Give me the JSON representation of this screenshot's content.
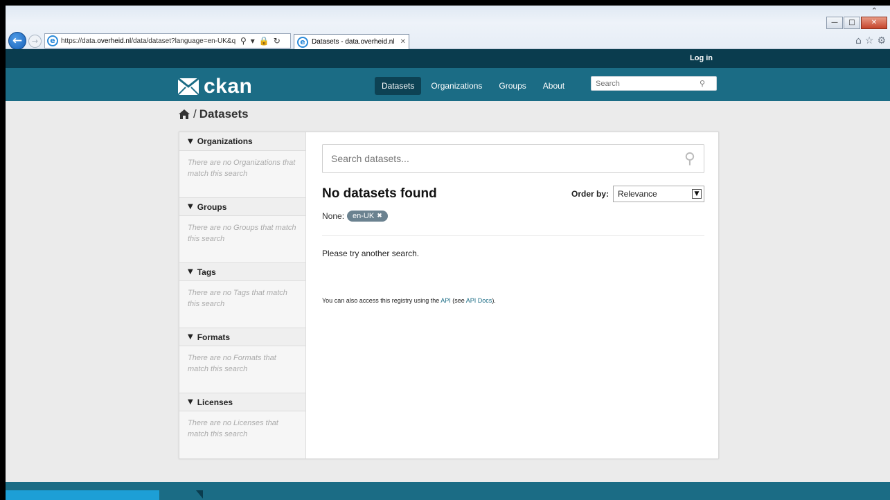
{
  "browser": {
    "url_prefix": "https://data.",
    "url_domain": "overheid.nl",
    "url_suffix": "/data/dataset?language=en-UK&q",
    "tab_title": "Datasets - data.overheid.nl",
    "icons": {
      "back": "back-arrow-icon",
      "forward": "forward-arrow-icon",
      "search": "magnifier-icon",
      "dropdown": "chevron-down-icon",
      "lock": "lock-icon",
      "refresh": "refresh-icon",
      "close": "close-icon",
      "home": "home-icon",
      "favorites": "star-icon",
      "tools": "gear-icon"
    }
  },
  "header": {
    "login": "Log in",
    "logo_text": "ckan",
    "nav": [
      {
        "label": "Datasets",
        "active": true
      },
      {
        "label": "Organizations",
        "active": false
      },
      {
        "label": "Groups",
        "active": false
      },
      {
        "label": "About",
        "active": false
      }
    ],
    "search_placeholder": "Search"
  },
  "breadcrumb": {
    "separator": "/",
    "current": "Datasets"
  },
  "facets": [
    {
      "title": "Organizations",
      "empty": "There are no Organizations that match this search"
    },
    {
      "title": "Groups",
      "empty": "There are no Groups that match this search"
    },
    {
      "title": "Tags",
      "empty": "There are no Tags that match this search"
    },
    {
      "title": "Formats",
      "empty": "There are no Formats that match this search"
    },
    {
      "title": "Licenses",
      "empty": "There are no Licenses that match this search"
    }
  ],
  "main": {
    "search_placeholder": "Search datasets...",
    "result_title": "No datasets found",
    "order_label": "Order by:",
    "order_value": "Relevance",
    "filter_label": "None:",
    "filter_pill": "en-UK",
    "try_again": "Please try another search.",
    "api_prefix": "You can also access this registry using the ",
    "api_link": "API",
    "api_middle": " (see ",
    "api_docs_link": "API Docs",
    "api_suffix": ")."
  },
  "colors": {
    "account_bar": "#0a3c4e",
    "masthead": "#1b6c85",
    "pill": "#6b8290"
  }
}
